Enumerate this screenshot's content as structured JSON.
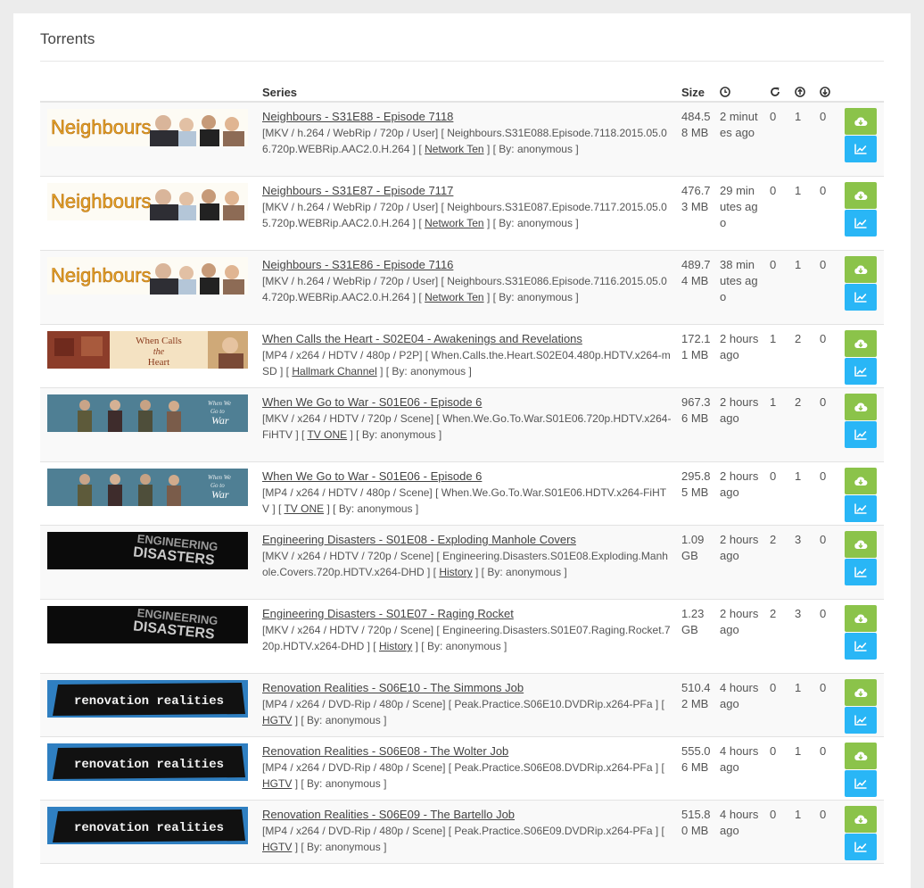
{
  "panel": {
    "title": "Torrents"
  },
  "header": {
    "series": "Series",
    "size": "Size",
    "age_icon": "clock-icon",
    "completed_icon": "refresh-icon",
    "seeders_icon": "upload-circle-icon",
    "leechers_icon": "download-circle-icon"
  },
  "colors": {
    "download_button": "#8bc34a",
    "stats_button": "#29b6f6"
  },
  "rows": [
    {
      "show": "neighbours",
      "title": "Neighbours - S31E88 - Episode 7118",
      "meta_pre": "[MKV / h.264 / WebRip / 720p / User] [ Neighbours.S31E088.Episode.7118.2015.05.06.720p.WEBRip.AAC2.0.H.264 ] [",
      "network": "Network Ten",
      "meta_post": "] [ By: anonymous ]",
      "size": "484.58 MB",
      "age": "2 minutes ago",
      "completed": "0",
      "seeders": "1",
      "leechers": "0"
    },
    {
      "show": "neighbours",
      "title": "Neighbours - S31E87 - Episode 7117",
      "meta_pre": "[MKV / h.264 / WebRip / 720p / User] [ Neighbours.S31E087.Episode.7117.2015.05.05.720p.WEBRip.AAC2.0.H.264 ] [",
      "network": "Network Ten",
      "meta_post": "] [ By: anonymous ]",
      "size": "476.73 MB",
      "age": "29 minutes ago",
      "completed": "0",
      "seeders": "1",
      "leechers": "0"
    },
    {
      "show": "neighbours",
      "title": "Neighbours - S31E86 - Episode 7116",
      "meta_pre": "[MKV / h.264 / WebRip / 720p / User] [ Neighbours.S31E086.Episode.7116.2015.05.04.720p.WEBRip.AAC2.0.H.264 ] [",
      "network": "Network Ten",
      "meta_post": "] [ By: anonymous ]",
      "size": "489.74 MB",
      "age": "38 minutes ago",
      "completed": "0",
      "seeders": "1",
      "leechers": "0"
    },
    {
      "show": "heart",
      "title": "When Calls the Heart - S02E04 - Awakenings and Revelations",
      "meta_pre": "[MP4 / x264 / HDTV / 480p / P2P] [ When.Calls.the.Heart.S02E04.480p.HDTV.x264-mSD ] [",
      "network": "Hallmark Channel",
      "meta_post": "] [ By: anonymous ]",
      "size": "172.11 MB",
      "age": "2 hours ago",
      "completed": "1",
      "seeders": "2",
      "leechers": "0"
    },
    {
      "show": "war",
      "title": "When We Go to War - S01E06 - Episode 6",
      "meta_pre": "[MKV / x264 / HDTV / 720p / Scene] [ When.We.Go.To.War.S01E06.720p.HDTV.x264-FiHTV ] [",
      "network": "TV ONE",
      "meta_post": "] [ By: anonymous ]",
      "size": "967.36 MB",
      "age": "2 hours ago",
      "completed": "1",
      "seeders": "2",
      "leechers": "0"
    },
    {
      "show": "war",
      "title": "When We Go to War - S01E06 - Episode 6",
      "meta_pre": "[MP4 / x264 / HDTV / 480p / Scene] [ When.We.Go.To.War.S01E06.HDTV.x264-FiHTV ] [",
      "network": "TV ONE",
      "meta_post": "] [ By: anonymous ]",
      "size": "295.85 MB",
      "age": "2 hours ago",
      "completed": "0",
      "seeders": "1",
      "leechers": "0"
    },
    {
      "show": "engineering",
      "title": "Engineering Disasters - S01E08 - Exploding Manhole Covers",
      "meta_pre": "[MKV / x264 / HDTV / 720p / Scene] [ Engineering.Disasters.S01E08.Exploding.Manhole.Covers.720p.HDTV.x264-DHD ] [",
      "network": "History",
      "meta_post": "] [ By: anonymous ]",
      "size": "1.09 GB",
      "age": "2 hours ago",
      "completed": "2",
      "seeders": "3",
      "leechers": "0"
    },
    {
      "show": "engineering",
      "title": "Engineering Disasters - S01E07 - Raging Rocket",
      "meta_pre": "[MKV / x264 / HDTV / 720p / Scene] [ Engineering.Disasters.S01E07.Raging.Rocket.720p.HDTV.x264-DHD ] [",
      "network": "History",
      "meta_post": "] [ By: anonymous ]",
      "size": "1.23 GB",
      "age": "2 hours ago",
      "completed": "2",
      "seeders": "3",
      "leechers": "0"
    },
    {
      "show": "renovation",
      "title": "Renovation Realities - S06E10 - The Simmons Job",
      "meta_pre": "[MP4 / x264 / DVD-Rip / 480p / Scene] [ Peak.Practice.S06E10.DVDRip.x264-PFa ] [",
      "network": "HGTV",
      "meta_post": "] [ By: anonymous ]",
      "size": "510.42 MB",
      "age": "4 hours ago",
      "completed": "0",
      "seeders": "1",
      "leechers": "0"
    },
    {
      "show": "renovation",
      "title": "Renovation Realities - S06E08 - The Wolter Job",
      "meta_pre": "[MP4 / x264 / DVD-Rip / 480p / Scene] [ Peak.Practice.S06E08.DVDRip.x264-PFa ] [",
      "network": "HGTV",
      "meta_post": "] [ By: anonymous ]",
      "size": "555.06 MB",
      "age": "4 hours ago",
      "completed": "0",
      "seeders": "1",
      "leechers": "0"
    },
    {
      "show": "renovation",
      "title": "Renovation Realities - S06E09 - The Bartello Job",
      "meta_pre": "[MP4 / x264 / DVD-Rip / 480p / Scene] [ Peak.Practice.S06E09.DVDRip.x264-PFa ] [",
      "network": "HGTV",
      "meta_post": "] [ By: anonymous ]",
      "size": "515.80 MB",
      "age": "4 hours ago",
      "completed": "0",
      "seeders": "1",
      "leechers": "0"
    }
  ],
  "thumb_text": {
    "neighbours": "Neighbours",
    "heart_1": "When Calls",
    "heart_2": "the",
    "heart_3": "Heart",
    "war_1": "When We",
    "war_2": "Go to",
    "war_3": "War",
    "engineering_1": "ENGINEERING",
    "engineering_2": "DISASTERS",
    "renovation": "renovation realities"
  }
}
